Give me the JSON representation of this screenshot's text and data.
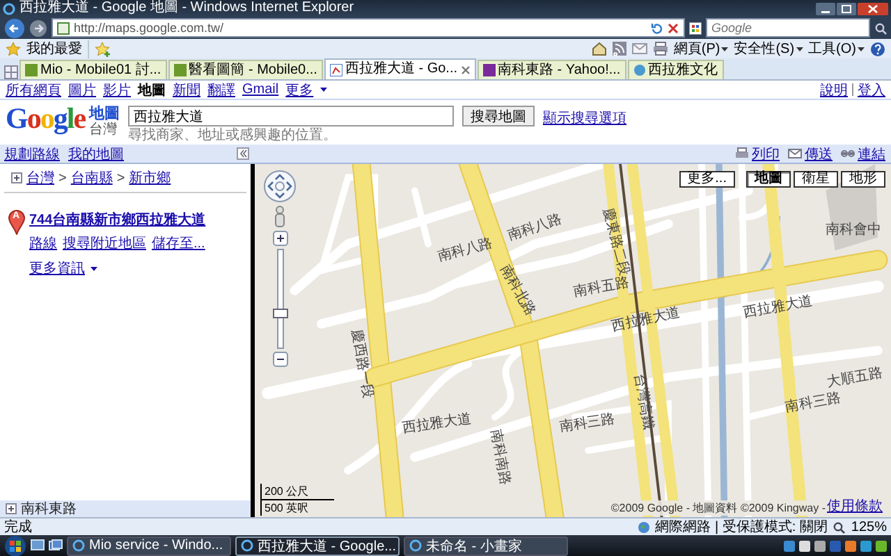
{
  "window": {
    "title": "西拉雅大道 - Google 地圖 - Windows Internet Explorer"
  },
  "address_bar": {
    "url": "http://maps.google.com.tw/",
    "search_placeholder": "Google"
  },
  "favorites_bar": {
    "label": "我的最愛"
  },
  "tabs": [
    {
      "label": "Mio - Mobile01 討...",
      "selected": false
    },
    {
      "label": "醫看圖簡 - Mobile0...",
      "selected": false
    },
    {
      "label": "西拉雅大道 - Go...",
      "selected": true
    },
    {
      "label": "南科東路 - Yahoo!...",
      "selected": false
    },
    {
      "label": "西拉雅文化",
      "selected": false
    }
  ],
  "command_bar": {
    "menus": [
      "網頁(P)",
      "安全性(S)",
      "工具(O)"
    ]
  },
  "google_nav": {
    "links": [
      {
        "label": "所有網頁",
        "selected": false
      },
      {
        "label": "圖片",
        "selected": false
      },
      {
        "label": "影片",
        "selected": false
      },
      {
        "label": "地圖",
        "selected": true
      },
      {
        "label": "新聞",
        "selected": false
      },
      {
        "label": "翻譯",
        "selected": false
      },
      {
        "label": "Gmail",
        "selected": false
      },
      {
        "label": "更多",
        "selected": false
      }
    ],
    "right_links": [
      "說明",
      "登入"
    ]
  },
  "search": {
    "logo": "Google",
    "product": "地圖",
    "region": "台灣",
    "value": "西拉雅大道",
    "hint": "尋找商家、地址或感興趣的位置。",
    "button": "搜尋地圖",
    "options_link": "顯示搜尋選項"
  },
  "panel_bar": {
    "links": [
      "規劃路線",
      "我的地圖"
    ],
    "actions": [
      "列印",
      "傳送",
      "連結"
    ]
  },
  "sidebar": {
    "breadcrumb": [
      "台灣",
      "台南縣",
      "新市鄉"
    ],
    "separator": ">",
    "result": {
      "marker": "A",
      "title": "744台南縣新市鄉西拉雅大道",
      "links": [
        "路線",
        "搜尋附近地區",
        "儲存至...",
        "更多資訊"
      ]
    },
    "footer": "南科東路"
  },
  "map": {
    "more_button": "更多...",
    "types": [
      {
        "label": "地圖",
        "selected": true
      },
      {
        "label": "衛星",
        "selected": false
      },
      {
        "label": "地形",
        "selected": false
      }
    ],
    "labels": [
      "南科八路",
      "南科八路",
      "南科五路",
      "西拉雅大道",
      "西拉雅大道",
      "西拉雅大道",
      "南科三路",
      "南科三路",
      "南科北路",
      "南科南路",
      "慶西路一段",
      "慶東路二段",
      "台灣高鐵",
      "大順五路",
      "南科會中"
    ],
    "zoom_slider": {
      "level": 0.35
    },
    "scale": [
      "200 公尺",
      "500 英呎"
    ],
    "copyright": "©2009 Google - 地圖資料 ©2009 Kingway - ",
    "terms_link": "使用條款"
  },
  "status_bar": {
    "text": "完成",
    "zone": "網際網路 | 受保護模式: 關閉",
    "zoom": "125%"
  },
  "taskbar": {
    "items": [
      {
        "label": "Mio service - Windo...",
        "selected": false
      },
      {
        "label": "西拉雅大道 - Google...",
        "selected": true
      },
      {
        "label": "未命名 - 小畫家",
        "selected": false
      }
    ]
  }
}
